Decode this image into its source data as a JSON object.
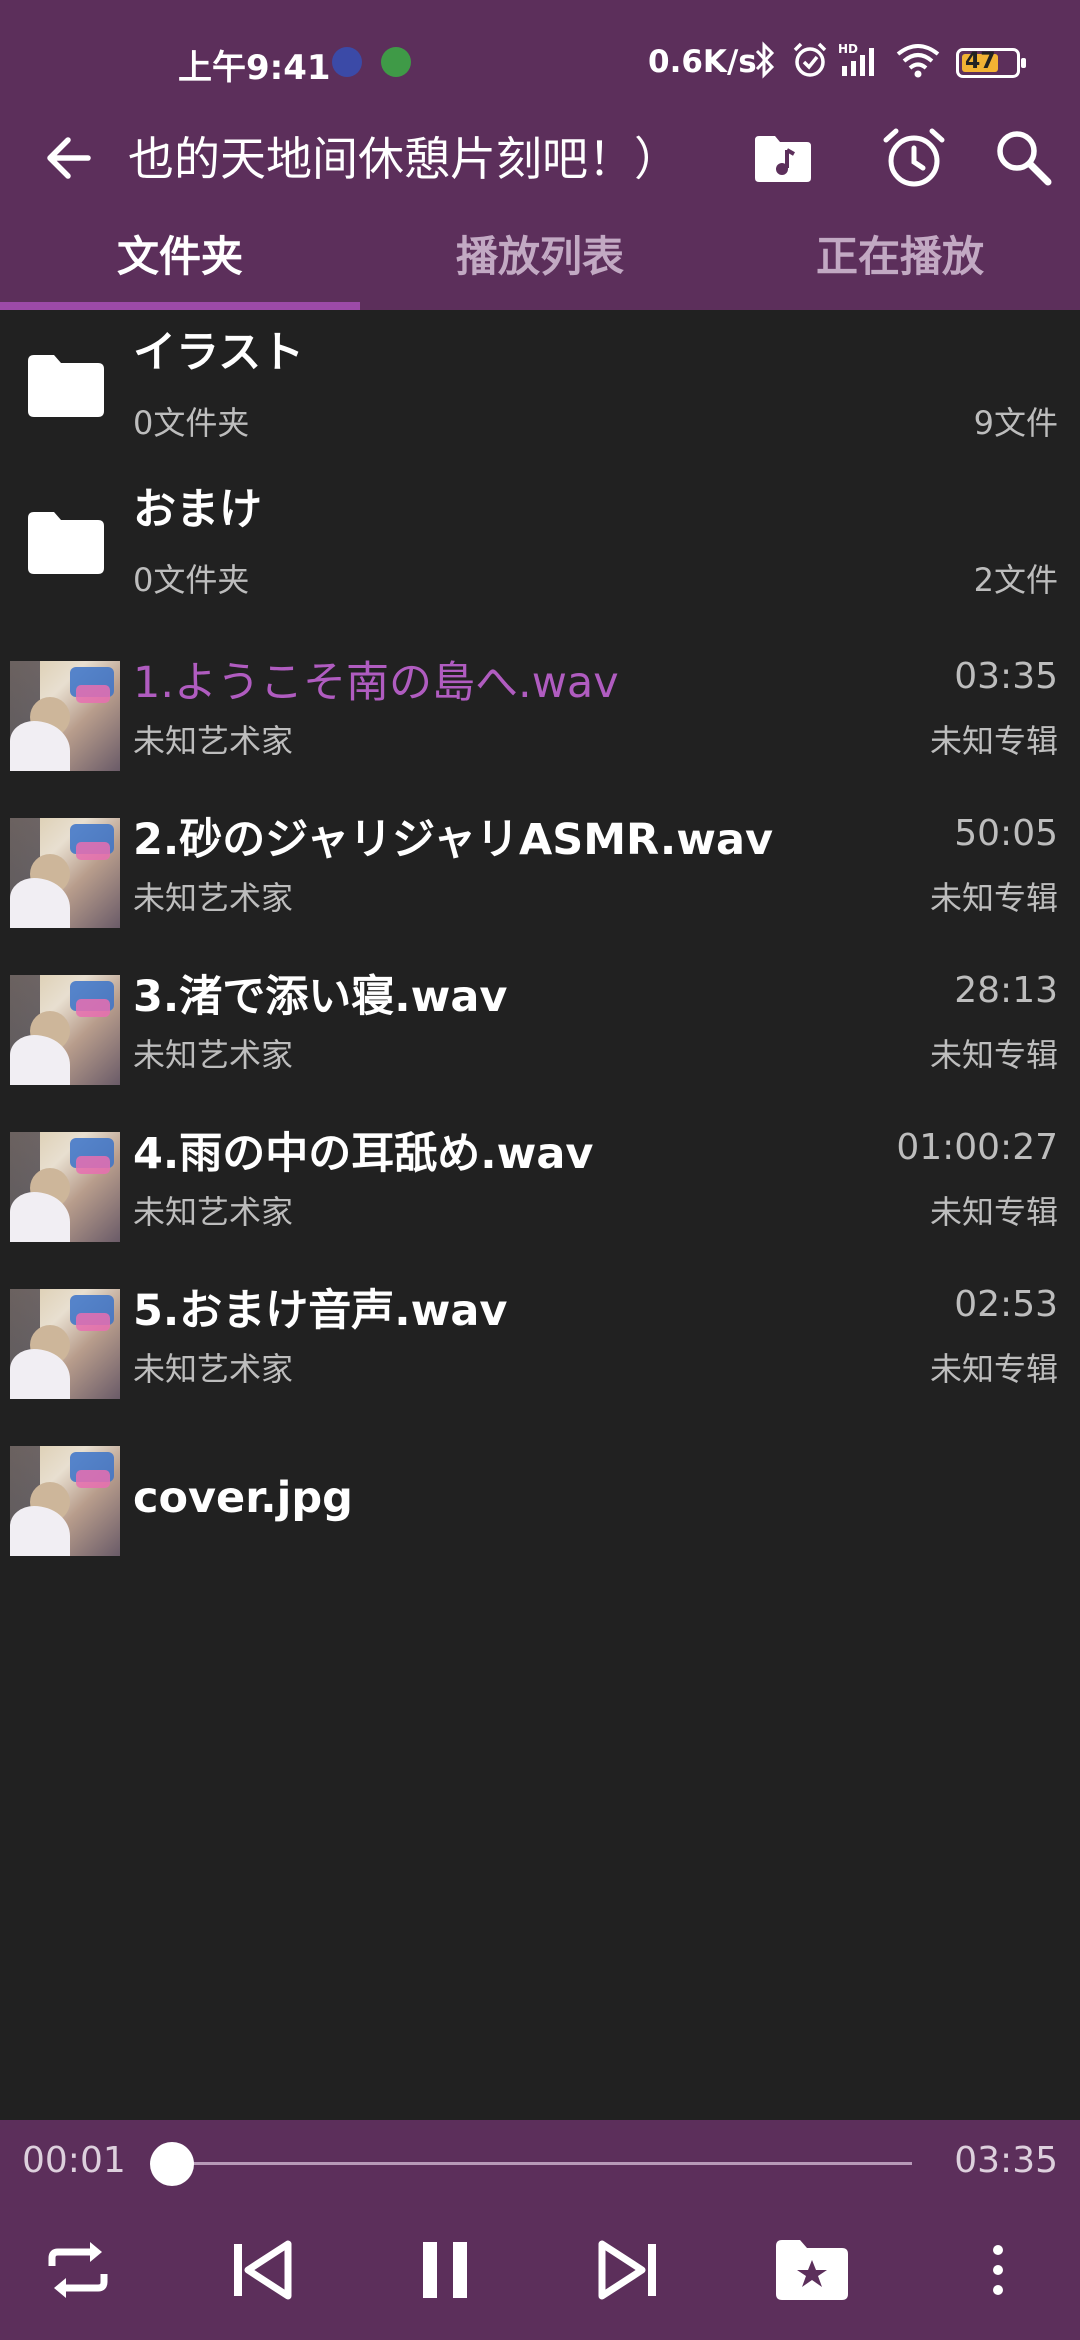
{
  "status_bar": {
    "time": "上午9:41",
    "net_speed": "0.6K/s",
    "battery": "47",
    "icons": [
      "music-notification-icon",
      "android-notification-icon",
      "bluetooth-icon",
      "alarm-icon",
      "signal-hd-icon",
      "wifi-icon",
      "battery-icon"
    ]
  },
  "app_bar": {
    "title": "也的天地间休憩片刻吧！）",
    "icons": [
      "back-arrow-icon",
      "music-folder-icon",
      "alarm-clock-icon",
      "search-icon"
    ]
  },
  "tabs": [
    {
      "label": "文件夹",
      "active": true
    },
    {
      "label": "播放列表",
      "active": false
    },
    {
      "label": "正在播放",
      "active": false
    }
  ],
  "folders": [
    {
      "name": "イラスト",
      "subfolders": "0文件夹",
      "files": "9文件"
    },
    {
      "name": "おまけ",
      "subfolders": "0文件夹",
      "files": "2文件"
    }
  ],
  "tracks": [
    {
      "name": "1.ようこそ南の島へ.wav",
      "artist": "未知艺术家",
      "duration": "03:35",
      "album": "未知专辑",
      "playing": true
    },
    {
      "name": "2.砂のジャリジャリASMR.wav",
      "artist": "未知艺术家",
      "duration": "50:05",
      "album": "未知专辑",
      "playing": false
    },
    {
      "name": "3.渚で添い寝.wav",
      "artist": "未知艺术家",
      "duration": "28:13",
      "album": "未知专辑",
      "playing": false
    },
    {
      "name": "4.雨の中の耳舐め.wav",
      "artist": "未知艺术家",
      "duration": "01:00:27",
      "album": "未知专辑",
      "playing": false
    },
    {
      "name": "5.おまけ音声.wav",
      "artist": "未知艺术家",
      "duration": "02:53",
      "album": "未知专辑",
      "playing": false
    }
  ],
  "files": [
    {
      "name": "cover.jpg"
    }
  ],
  "player": {
    "elapsed": "00:01",
    "total": "03:35",
    "progress_fraction": 0.005,
    "controls": [
      "repeat-icon",
      "previous-icon",
      "pause-icon",
      "next-icon",
      "favorite-folder-icon",
      "more-vert-icon"
    ]
  },
  "colors": {
    "primary": "#5c2f5b",
    "accent": "#b05cc0",
    "background": "#212121"
  }
}
